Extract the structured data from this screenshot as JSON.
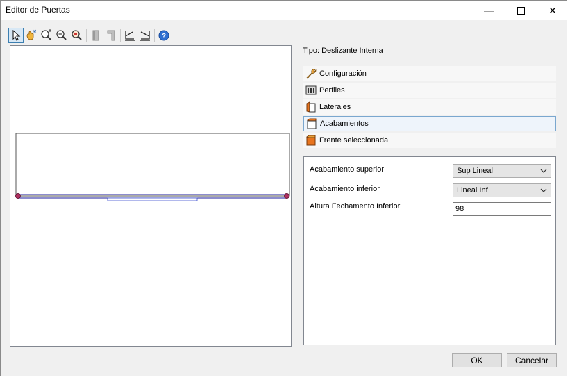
{
  "window": {
    "title": "Editor de Puertas",
    "minimize_glyph": "—",
    "close_glyph": "✕"
  },
  "toolbar": {
    "tools": [
      {
        "name": "pointer-icon"
      },
      {
        "name": "pan-hand-icon"
      },
      {
        "name": "zoom-in-icon"
      },
      {
        "name": "zoom-out-icon"
      },
      {
        "name": "zoom-extents-icon"
      },
      {
        "name": "profile-left-icon"
      },
      {
        "name": "profile-right-icon"
      },
      {
        "name": "edit-left-icon"
      },
      {
        "name": "edit-right-icon"
      },
      {
        "name": "help-icon"
      }
    ]
  },
  "editor": {
    "tipo": "Tipo: Deslizante Interna",
    "sections": [
      {
        "label": "Configuración",
        "icon": "wrench-icon"
      },
      {
        "label": "Perfiles",
        "icon": "profiles-icon"
      },
      {
        "label": "Laterales",
        "icon": "side-panel-icon"
      },
      {
        "label": "Acabamientos",
        "icon": "finish-icon"
      },
      {
        "label": "Frente seleccionada",
        "icon": "front-selected-icon"
      }
    ],
    "active_section": "Acabamientos",
    "fields": {
      "acab_sup_label": "Acabamiento superior",
      "acab_sup_value": "Sup Lineal",
      "acab_inf_label": "Acabamiento inferior",
      "acab_inf_value": "Lineal Inf",
      "altura_label": "Altura Fechamento Inferior",
      "altura_value": "98"
    }
  },
  "buttons": {
    "ok": "OK",
    "cancel": "Cancelar"
  },
  "colors": {
    "accent": "#3c7fb1",
    "drawing_line": "#1a1a9c",
    "marker": "#b03060",
    "icon_orange": "#e8741e"
  }
}
